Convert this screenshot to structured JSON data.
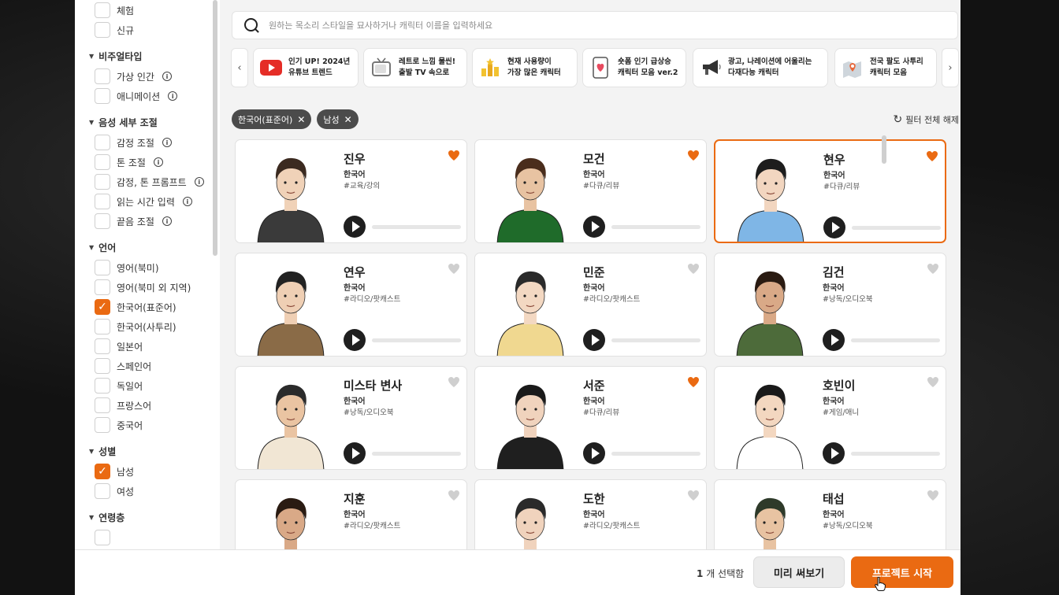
{
  "sidebar": {
    "top_items": [
      {
        "label": "체험",
        "checked": false
      },
      {
        "label": "신규",
        "checked": false
      }
    ],
    "sections": [
      {
        "title": "비주얼타입",
        "items": [
          {
            "label": "가상 인간",
            "checked": false,
            "info": true
          },
          {
            "label": "애니메이션",
            "checked": false,
            "info": true
          }
        ]
      },
      {
        "title": "음성 세부 조절",
        "items": [
          {
            "label": "감정 조절",
            "checked": false,
            "info": true
          },
          {
            "label": "톤 조절",
            "checked": false,
            "info": true
          },
          {
            "label": "감정, 톤 프롬프트",
            "checked": false,
            "info": true
          },
          {
            "label": "읽는 시간 입력",
            "checked": false,
            "info": true
          },
          {
            "label": "끝음 조절",
            "checked": false,
            "info": true
          }
        ]
      },
      {
        "title": "언어",
        "items": [
          {
            "label": "영어(북미)",
            "checked": false
          },
          {
            "label": "영어(북미 외 지역)",
            "checked": false
          },
          {
            "label": "한국어(표준어)",
            "checked": true
          },
          {
            "label": "한국어(사투리)",
            "checked": false
          },
          {
            "label": "일본어",
            "checked": false
          },
          {
            "label": "스페인어",
            "checked": false
          },
          {
            "label": "독일어",
            "checked": false
          },
          {
            "label": "프랑스어",
            "checked": false
          },
          {
            "label": "중국어",
            "checked": false
          }
        ]
      },
      {
        "title": "성별",
        "items": [
          {
            "label": "남성",
            "checked": true
          },
          {
            "label": "여성",
            "checked": false
          }
        ]
      },
      {
        "title": "연령층",
        "items": []
      }
    ]
  },
  "search": {
    "placeholder": "원하는 목소리 스타일을 묘사하거나 캐릭터 이름을 입력하세요"
  },
  "banners": [
    {
      "line1": "인기 UP! 2024년",
      "line2": "유튜브 트렌드",
      "icon": "youtube-icon",
      "color": "#e52d27"
    },
    {
      "line1": "레트로 느낌 물씬!",
      "line2": "출발 TV 속으로",
      "icon": "tv-icon",
      "color": "#777777"
    },
    {
      "line1": "현재 사용량이",
      "line2": "가장 많은 캐릭터",
      "icon": "trophy-icon",
      "color": "#f2c230"
    },
    {
      "line1": "숏폼 인기 급상승",
      "line2": "캐릭터 모음 ver.2",
      "icon": "phone-heart-icon",
      "color": "#e84a5f"
    },
    {
      "line1": "광고, 나레이션에 어울리는",
      "line2": "다재다능 캐릭터",
      "icon": "megaphone-icon",
      "color": "#333333"
    },
    {
      "line1": "전국 팔도 사투리",
      "line2": "캐릭터 모음",
      "icon": "map-pin-icon",
      "color": "#e8673a"
    }
  ],
  "filters": {
    "chips": [
      "한국어(표준어)",
      "남성"
    ],
    "reset_label": "필터 전체 해제"
  },
  "characters": [
    {
      "name": "진우",
      "lang": "한국어",
      "tag": "#교육/강의",
      "fav": true,
      "selected": false,
      "shirt": "#3a3a3a",
      "hair": "#3b2a20",
      "skin": "#f0d2b8"
    },
    {
      "name": "모건",
      "lang": "한국어",
      "tag": "#다큐/리뷰",
      "fav": true,
      "selected": false,
      "shirt": "#1f6b2a",
      "hair": "#4a2d1c",
      "skin": "#e8c3a2"
    },
    {
      "name": "현우",
      "lang": "한국어",
      "tag": "#다큐/리뷰",
      "fav": true,
      "selected": true,
      "shirt": "#7fb6e6",
      "hair": "#1d1d1d",
      "skin": "#f2d6c0"
    },
    {
      "name": "연우",
      "lang": "한국어",
      "tag": "#라디오/팟캐스트",
      "fav": false,
      "selected": false,
      "shirt": "#8a6b47",
      "hair": "#222222",
      "skin": "#efcfb4"
    },
    {
      "name": "민준",
      "lang": "한국어",
      "tag": "#라디오/팟캐스트",
      "fav": false,
      "selected": false,
      "shirt": "#f0d890",
      "hair": "#2a2a2a",
      "skin": "#f3d8c2"
    },
    {
      "name": "김건",
      "lang": "한국어",
      "tag": "#낭독/오디오북",
      "fav": false,
      "selected": false,
      "shirt": "#4d6b3a",
      "hair": "#2a1b12",
      "skin": "#d9a987"
    },
    {
      "name": "미스타 변사",
      "lang": "한국어",
      "tag": "#낭독/오디오북",
      "fav": false,
      "selected": false,
      "shirt": "#f1e6d4",
      "hair": "#2b2b2b",
      "skin": "#eac4a2"
    },
    {
      "name": "서준",
      "lang": "한국어",
      "tag": "#다큐/리뷰",
      "fav": true,
      "selected": false,
      "shirt": "#1f1f1f",
      "hair": "#1a1a1a",
      "skin": "#f0d3bd"
    },
    {
      "name": "호빈이",
      "lang": "한국어",
      "tag": "#게임/애니",
      "fav": false,
      "selected": false,
      "shirt": "#ffffff",
      "hair": "#1a1a1a",
      "skin": "#f3d7c0"
    },
    {
      "name": "지훈",
      "lang": "한국어",
      "tag": "#라디오/팟캐스트",
      "fav": false,
      "selected": false,
      "shirt": "#8a4fa3",
      "hair": "#2a1b12",
      "skin": "#d9a987"
    },
    {
      "name": "도한",
      "lang": "한국어",
      "tag": "#라디오/팟캐스트",
      "fav": false,
      "selected": false,
      "shirt": "#d8d3cc",
      "hair": "#2a2a2a",
      "skin": "#f0d3bd"
    },
    {
      "name": "태섭",
      "lang": "한국어",
      "tag": "#낭독/오디오북",
      "fav": false,
      "selected": false,
      "shirt": "#4a4a40",
      "hair": "#2e3a2a",
      "skin": "#e8c3a2"
    }
  ],
  "footer": {
    "count": "1",
    "count_suffix": "개 선택함",
    "preview_label": "미리 써보기",
    "start_label": "프로젝트 시작"
  },
  "colors": {
    "accent": "#ea6a12",
    "heart_off": "#cfcfcf"
  }
}
